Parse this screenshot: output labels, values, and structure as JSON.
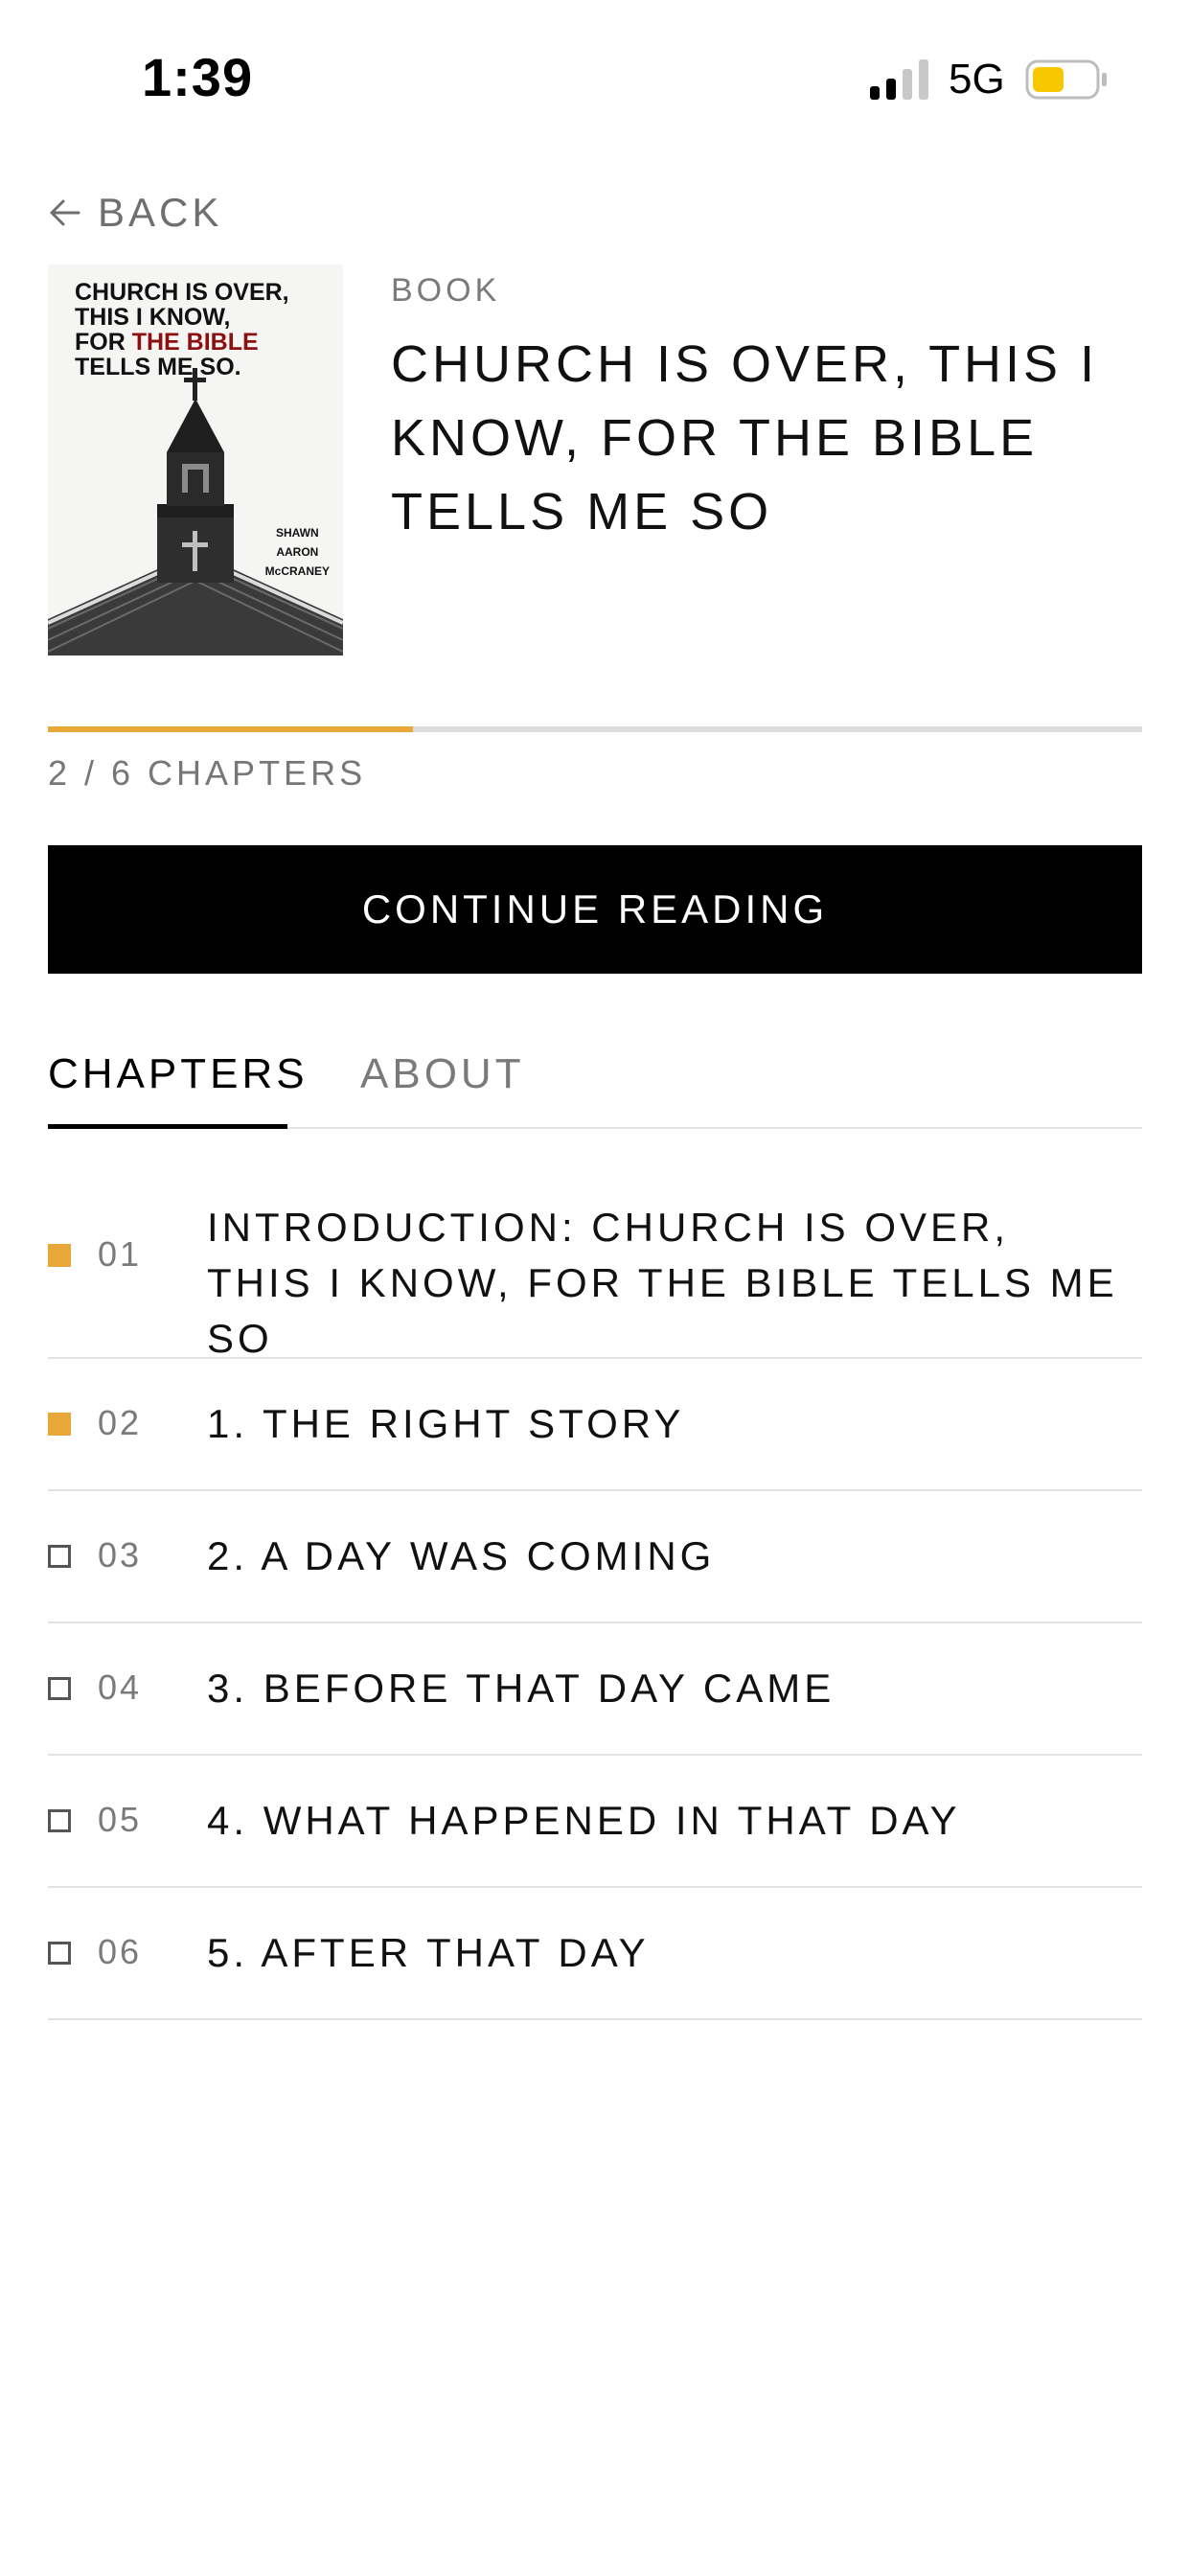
{
  "status_bar": {
    "time": "1:39",
    "network": "5G",
    "battery_color": "#f7c800"
  },
  "nav": {
    "back_label": "BACK"
  },
  "book": {
    "type_label": "BOOK",
    "title": "CHURCH IS OVER, THIS I KNOW, FOR THE BIBLE TELLS ME SO",
    "cover": {
      "title_line1": "CHURCH IS OVER,",
      "title_line2": "THIS I KNOW,",
      "title_line3_prefix": "FOR ",
      "title_line3_highlight": "THE BIBLE",
      "title_line4": "TELLS ME SO.",
      "author_line1": "SHAWN",
      "author_line2": "AARON",
      "author_line3": "McCRANEY"
    }
  },
  "progress": {
    "text": "2 / 6 CHAPTERS",
    "fraction": 0.3333,
    "color": "#e8a838"
  },
  "cta": {
    "label": "CONTINUE READING"
  },
  "tabs": [
    {
      "label": "CHAPTERS",
      "active": true
    },
    {
      "label": "ABOUT",
      "active": false
    }
  ],
  "chapters": [
    {
      "num": "01",
      "title": "INTRODUCTION: CHURCH IS OVER, THIS I KNOW, FOR THE BIBLE TELLS ME SO",
      "done": true
    },
    {
      "num": "02",
      "title": "1. THE RIGHT STORY",
      "done": true
    },
    {
      "num": "03",
      "title": "2. A DAY WAS COMING",
      "done": false
    },
    {
      "num": "04",
      "title": "3. BEFORE THAT DAY CAME",
      "done": false
    },
    {
      "num": "05",
      "title": "4. WHAT HAPPENED IN THAT DAY",
      "done": false
    },
    {
      "num": "06",
      "title": "5. AFTER THAT DAY",
      "done": false
    }
  ]
}
